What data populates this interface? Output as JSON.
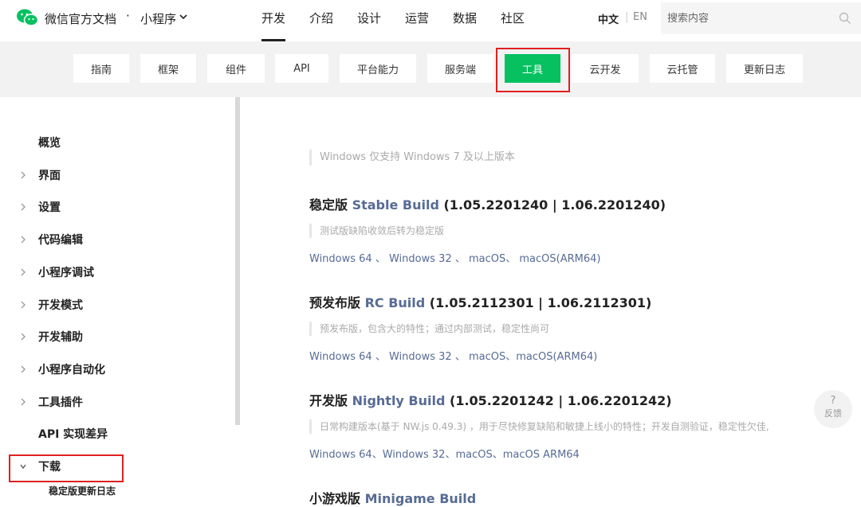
{
  "header": {
    "brand": "微信官方文档",
    "dot": "·",
    "product": "小程序",
    "nav": [
      "开发",
      "介绍",
      "设计",
      "运营",
      "数据",
      "社区"
    ],
    "lang_cn": "中文",
    "lang_sep": "|",
    "lang_en": "EN",
    "search_placeholder": "搜索内容"
  },
  "subnav": {
    "tabs": [
      "指南",
      "框架",
      "组件",
      "API",
      "平台能力",
      "服务端",
      "工具",
      "云开发",
      "云托管",
      "更新日志"
    ],
    "active": "工具"
  },
  "sidebar": {
    "items": [
      "概览",
      "界面",
      "设置",
      "代码编辑",
      "小程序调试",
      "开发模式",
      "开发辅助",
      "小程序自动化",
      "工具插件",
      "API 实现差异",
      "下载"
    ],
    "sub_item": "稳定版更新日志"
  },
  "content": {
    "windows_note": "Windows 仅支持 Windows 7 及以上版本",
    "stable": {
      "cn": "稳定版 ",
      "en": "Stable Build",
      "version": " (1.05.2201240 | 1.06.2201240)",
      "note": "测试版缺陷收敛后转为稳定版",
      "links": [
        "Windows 64",
        "Windows 32",
        "macOS",
        "macOS(ARM64)"
      ],
      "seps": [
        " 、 ",
        " 、 ",
        "、 "
      ]
    },
    "rc": {
      "cn": "预发布版 ",
      "en": "RC Build",
      "version": " (1.05.2112301 | 1.06.2112301)",
      "note": "预发布版，包含大的特性；通过内部测试，稳定性尚可",
      "links": [
        "Windows 64",
        "Windows 32",
        "macOS",
        "macOS(ARM64)"
      ],
      "seps": [
        " 、 ",
        " 、 ",
        "、"
      ]
    },
    "nightly": {
      "cn": "开发版 ",
      "en": "Nightly Build",
      "version": " (1.05.2201242 | 1.06.2201242)",
      "note": "日常构建版本(基于 NW.js 0.49.3) ，用于尽快修复缺陷和敏捷上线小的特性；开发自测验证，稳定性欠佳,",
      "links": [
        "Windows 64",
        "Windows 32",
        "macOS",
        "macOS ARM64"
      ],
      "seps": [
        "、",
        "、",
        "、"
      ]
    },
    "minigame": {
      "cn": "小游戏版 ",
      "en": "Minigame Build"
    }
  },
  "feedback": {
    "icon": "?",
    "label": "反馈"
  },
  "colors": {
    "accent": "#07c160",
    "link": "#576b95",
    "highlight": "#e02020"
  }
}
